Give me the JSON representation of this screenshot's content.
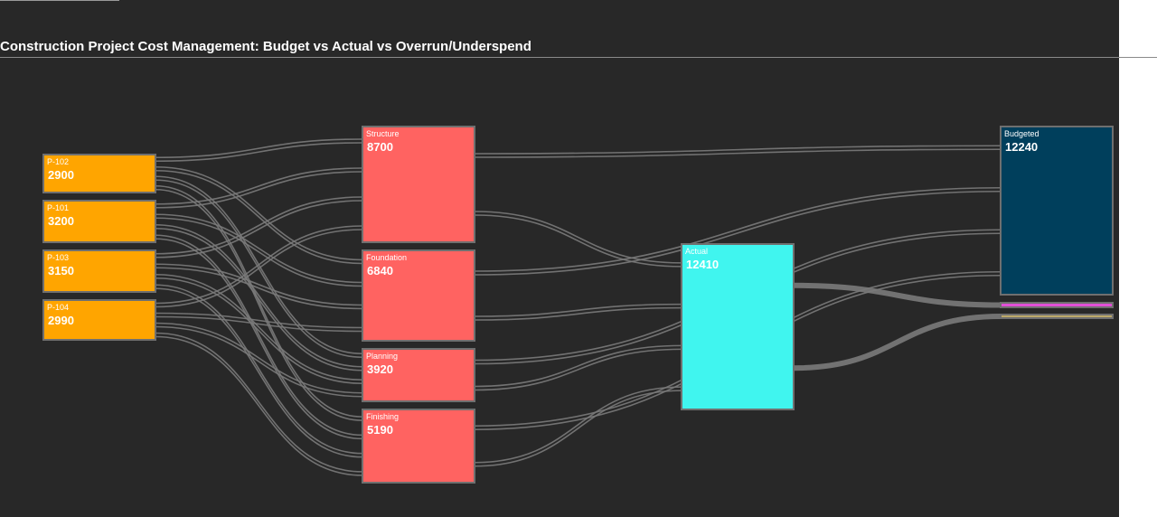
{
  "title": "Construction Project Cost Management: Budget vs Actual vs Overrun/Underspend",
  "colors": {
    "background": "#282828",
    "project": "#ffa500",
    "phase": "#ff6361",
    "actual": "#40f5ef",
    "budgeted": "#003f5c",
    "overrun": "#e14fd6",
    "underspend": "#bca96a",
    "link": "#7a7a7a",
    "node_border": "#6f6f6f"
  },
  "chart_data": {
    "type": "sankey",
    "nodes": [
      {
        "id": "P-102",
        "label": "P-102",
        "value": 2900,
        "column": 0,
        "group": "project"
      },
      {
        "id": "P-101",
        "label": "P-101",
        "value": 3200,
        "column": 0,
        "group": "project"
      },
      {
        "id": "P-103",
        "label": "P-103",
        "value": 3150,
        "column": 0,
        "group": "project"
      },
      {
        "id": "P-104",
        "label": "P-104",
        "value": 2990,
        "column": 0,
        "group": "project"
      },
      {
        "id": "Structure",
        "label": "Structure",
        "value": 8700,
        "column": 1,
        "group": "phase"
      },
      {
        "id": "Foundation",
        "label": "Foundation",
        "value": 6840,
        "column": 1,
        "group": "phase"
      },
      {
        "id": "Planning",
        "label": "Planning",
        "value": 3920,
        "column": 1,
        "group": "phase"
      },
      {
        "id": "Finishing",
        "label": "Finishing",
        "value": 5190,
        "column": 1,
        "group": "phase"
      },
      {
        "id": "Actual",
        "label": "Actual",
        "value": 12410,
        "column": 2,
        "group": "actual"
      },
      {
        "id": "Budgeted",
        "label": "Budgeted",
        "value": 12240,
        "column": 3,
        "group": "budgeted"
      },
      {
        "id": "Overrun",
        "label": "",
        "value": 350,
        "column": 3,
        "group": "overrun"
      },
      {
        "id": "Underspend",
        "label": "",
        "value": 180,
        "column": 3,
        "group": "underspend"
      }
    ],
    "links": [
      {
        "source": "P-102",
        "target": "Structure",
        "value": 1000
      },
      {
        "source": "P-102",
        "target": "Foundation",
        "value": 800
      },
      {
        "source": "P-102",
        "target": "Planning",
        "value": 500
      },
      {
        "source": "P-102",
        "target": "Finishing",
        "value": 600
      },
      {
        "source": "P-101",
        "target": "Structure",
        "value": 1200
      },
      {
        "source": "P-101",
        "target": "Foundation",
        "value": 900
      },
      {
        "source": "P-101",
        "target": "Planning",
        "value": 450
      },
      {
        "source": "P-101",
        "target": "Finishing",
        "value": 650
      },
      {
        "source": "P-103",
        "target": "Structure",
        "value": 1100
      },
      {
        "source": "P-103",
        "target": "Foundation",
        "value": 850
      },
      {
        "source": "P-103",
        "target": "Planning",
        "value": 520
      },
      {
        "source": "P-103",
        "target": "Finishing",
        "value": 680
      },
      {
        "source": "P-104",
        "target": "Structure",
        "value": 1050
      },
      {
        "source": "P-104",
        "target": "Foundation",
        "value": 870
      },
      {
        "source": "P-104",
        "target": "Planning",
        "value": 490
      },
      {
        "source": "P-104",
        "target": "Finishing",
        "value": 580
      },
      {
        "source": "Structure",
        "target": "Budgeted",
        "value": 4350
      },
      {
        "source": "Structure",
        "target": "Actual",
        "value": 4350
      },
      {
        "source": "Foundation",
        "target": "Budgeted",
        "value": 3420
      },
      {
        "source": "Foundation",
        "target": "Actual",
        "value": 3420
      },
      {
        "source": "Planning",
        "target": "Budgeted",
        "value": 1960
      },
      {
        "source": "Planning",
        "target": "Actual",
        "value": 1960
      },
      {
        "source": "Finishing",
        "target": "Budgeted",
        "value": 2510
      },
      {
        "source": "Finishing",
        "target": "Actual",
        "value": 2680
      },
      {
        "source": "Actual",
        "target": "Overrun",
        "value": 350
      },
      {
        "source": "Actual",
        "target": "Underspend",
        "value": 180
      }
    ]
  }
}
